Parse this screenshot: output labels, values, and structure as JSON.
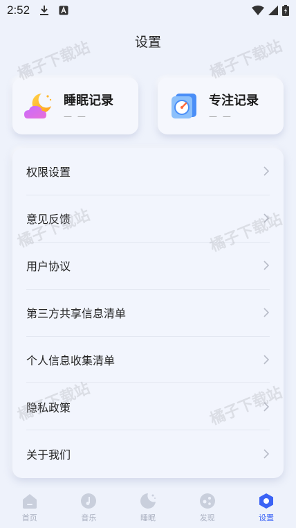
{
  "status_bar": {
    "time": "2:52"
  },
  "page": {
    "title": "设置"
  },
  "records": [
    {
      "title": "睡眠记录",
      "sub": "— —"
    },
    {
      "title": "专注记录",
      "sub": "— —"
    }
  ],
  "menu": [
    {
      "label": "权限设置"
    },
    {
      "label": "意见反馈"
    },
    {
      "label": "用户协议"
    },
    {
      "label": "第三方共享信息清单"
    },
    {
      "label": "个人信息收集清单"
    },
    {
      "label": "隐私政策"
    },
    {
      "label": "关于我们"
    }
  ],
  "tabs": [
    {
      "label": "首页",
      "icon": "home-icon",
      "active": false
    },
    {
      "label": "音乐",
      "icon": "music-icon",
      "active": false
    },
    {
      "label": "睡眠",
      "icon": "moon-icon",
      "active": false
    },
    {
      "label": "发现",
      "icon": "discover-icon",
      "active": false
    },
    {
      "label": "设置",
      "icon": "settings-icon",
      "active": true
    }
  ],
  "watermark": "橘子下载站",
  "colors": {
    "accent": "#3b63f5",
    "background": "#eef2fb",
    "inactive": "#aab0c0"
  }
}
